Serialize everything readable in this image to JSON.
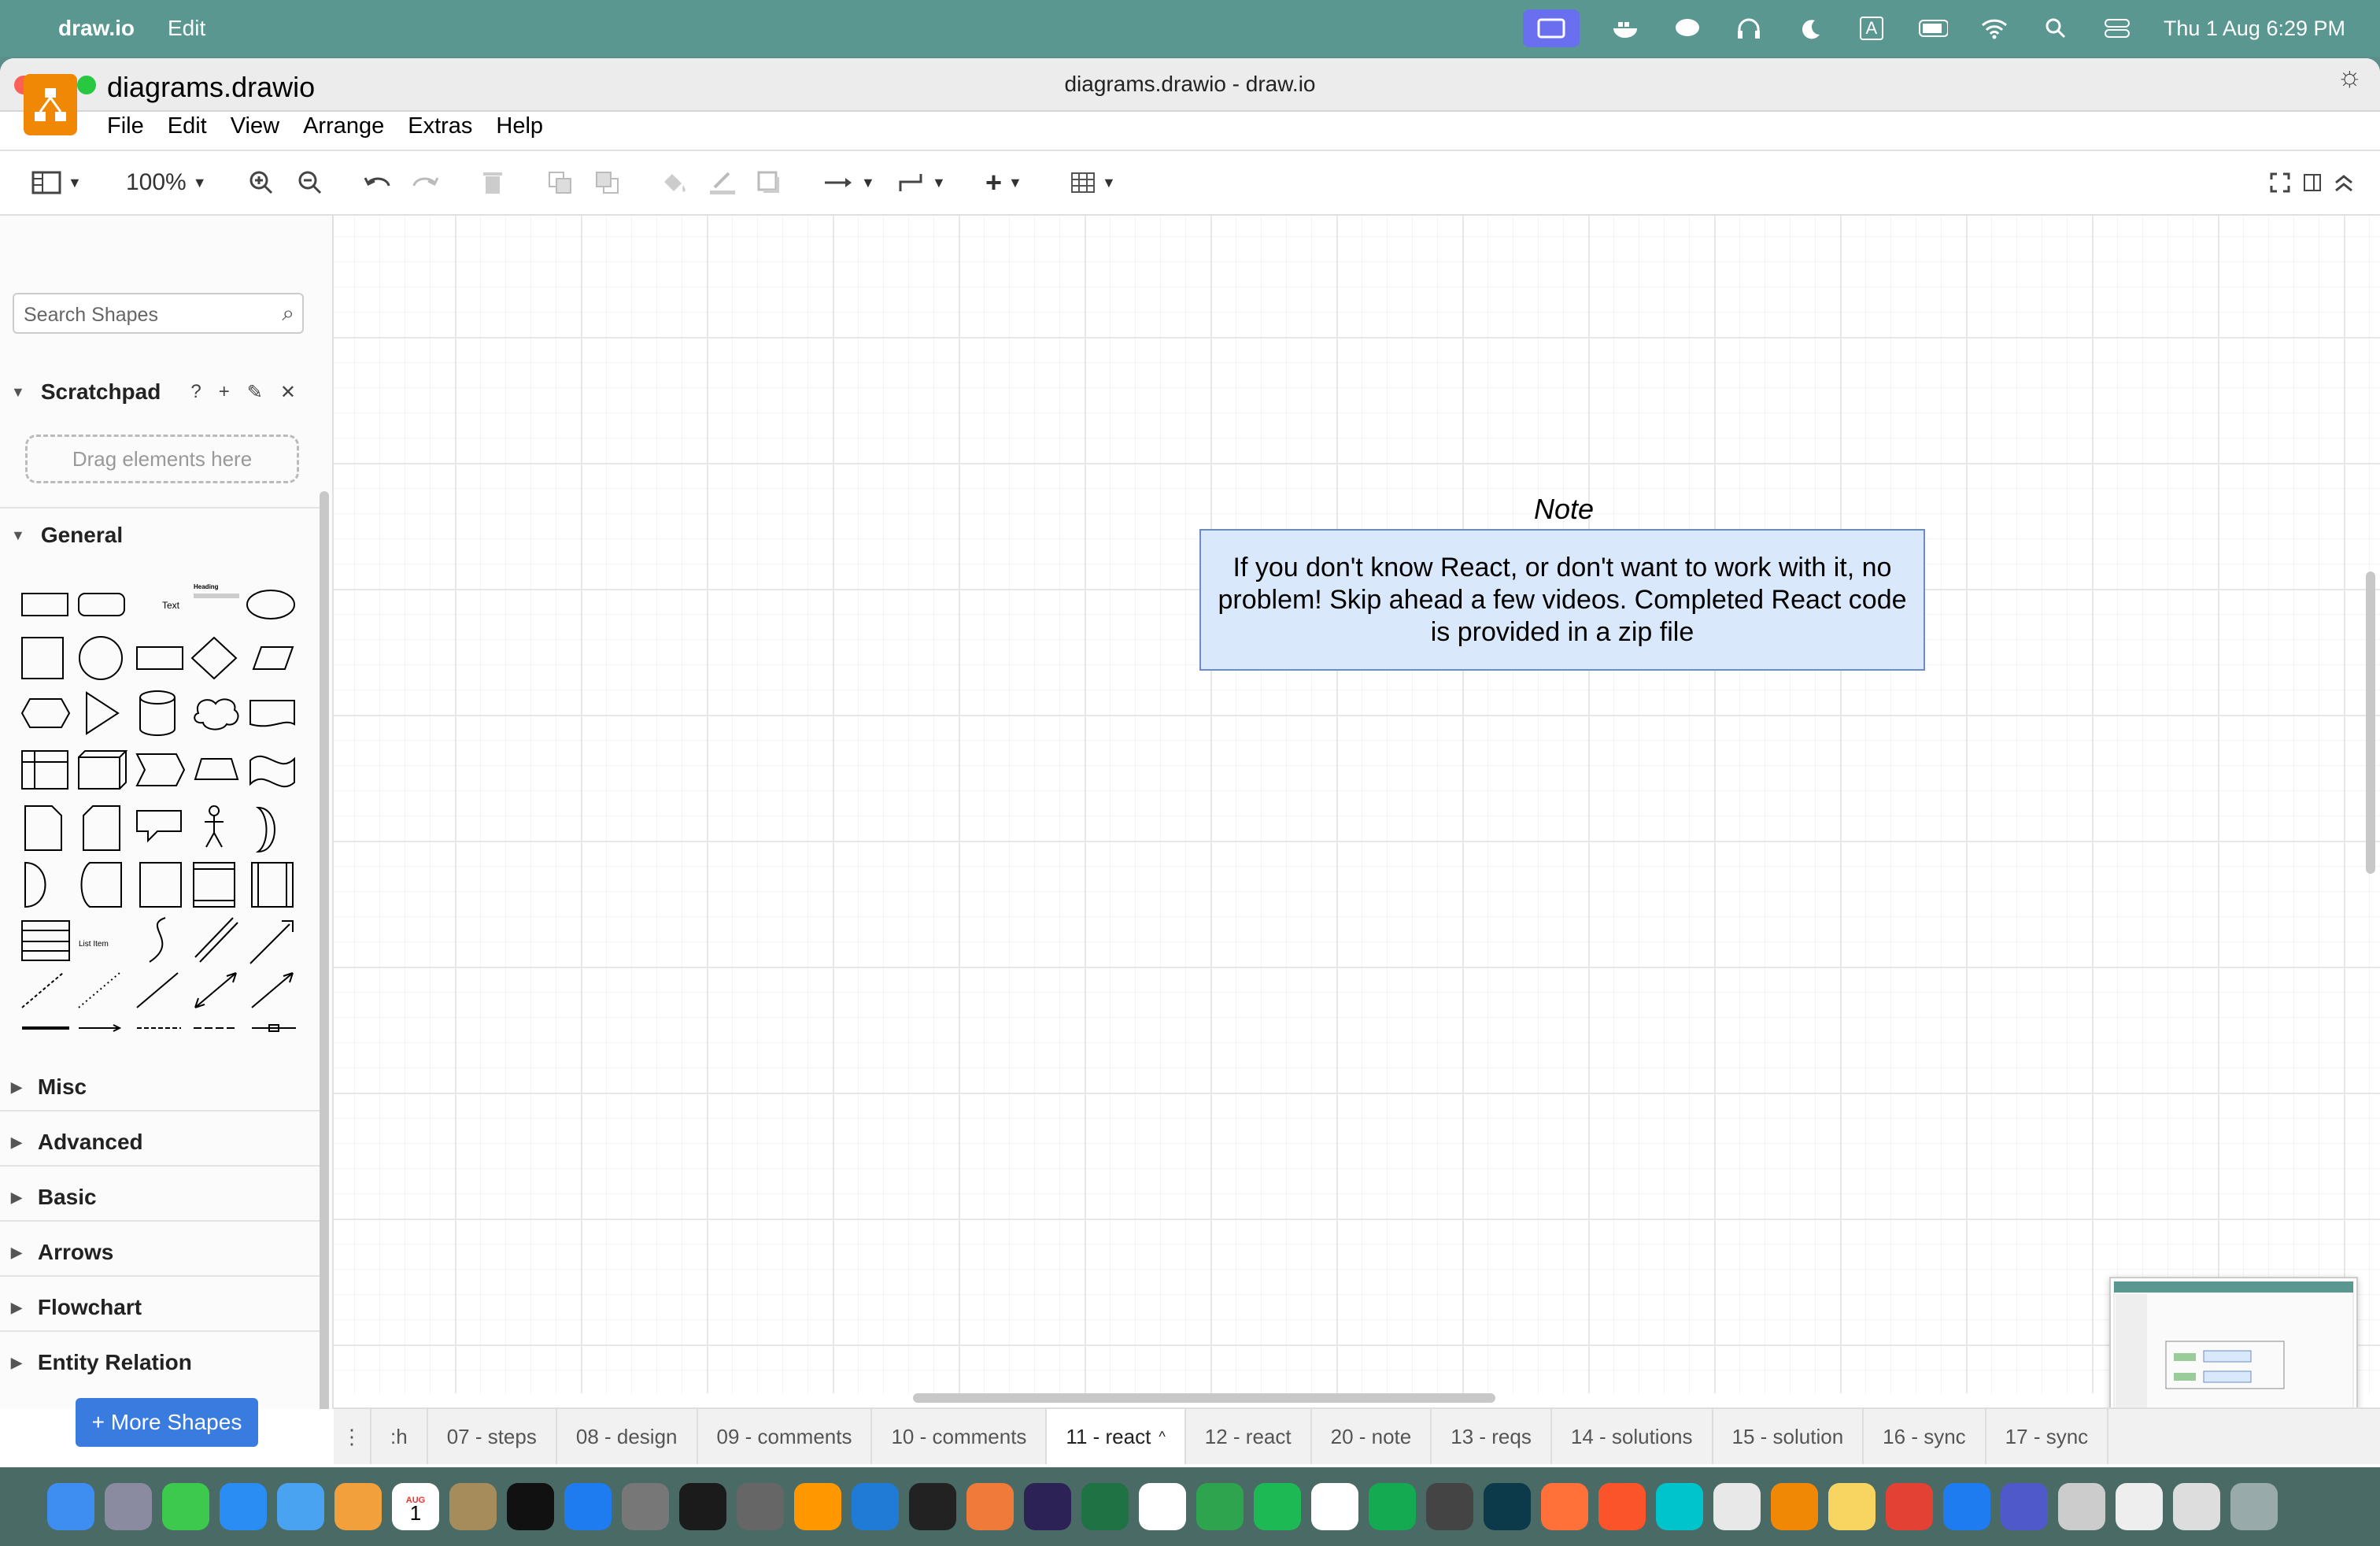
{
  "menubar": {
    "app_name": "draw.io",
    "edit": "Edit",
    "datetime": "Thu 1 Aug  6:29 PM",
    "input_source": "A"
  },
  "window": {
    "title": "diagrams.drawio - draw.io"
  },
  "header": {
    "doc_name": "diagrams.drawio",
    "menus": [
      "File",
      "Edit",
      "View",
      "Arrange",
      "Extras",
      "Help"
    ]
  },
  "toolbar": {
    "zoom": "100%"
  },
  "sidebar": {
    "search_placeholder": "Search Shapes",
    "scratchpad": "Scratchpad",
    "scratch_help": "?",
    "dropzone": "Drag elements here",
    "general": "General",
    "text_shape": "Text",
    "heading_shape": "Heading",
    "list_item_shape": "List Item",
    "sections": [
      "Misc",
      "Advanced",
      "Basic",
      "Arrows",
      "Flowchart",
      "Entity Relation"
    ],
    "more_shapes": "+ More Shapes"
  },
  "canvas": {
    "note_title": "Note",
    "note_text": "If you don't know React, or don't want to work with it, no problem! Skip ahead a few videos.  Completed React code is provided in a zip file"
  },
  "tabs": {
    "items": [
      ":h",
      "07 - steps",
      "08 - design",
      "09 - comments",
      "10 - comments",
      "11 - react",
      "12 - react",
      "20 - note",
      "13 - reqs",
      "14 - solutions",
      "15 - solution",
      "16 - sync",
      "17 - sync"
    ],
    "active": "11 - react"
  },
  "calendar": {
    "month": "AUG",
    "day": "1"
  },
  "colors": {
    "menubar": "#5b9791",
    "accent": "#3a7be0",
    "logo": "#f08705",
    "note_fill": "#dae8fc",
    "note_stroke": "#6c8ebf"
  }
}
